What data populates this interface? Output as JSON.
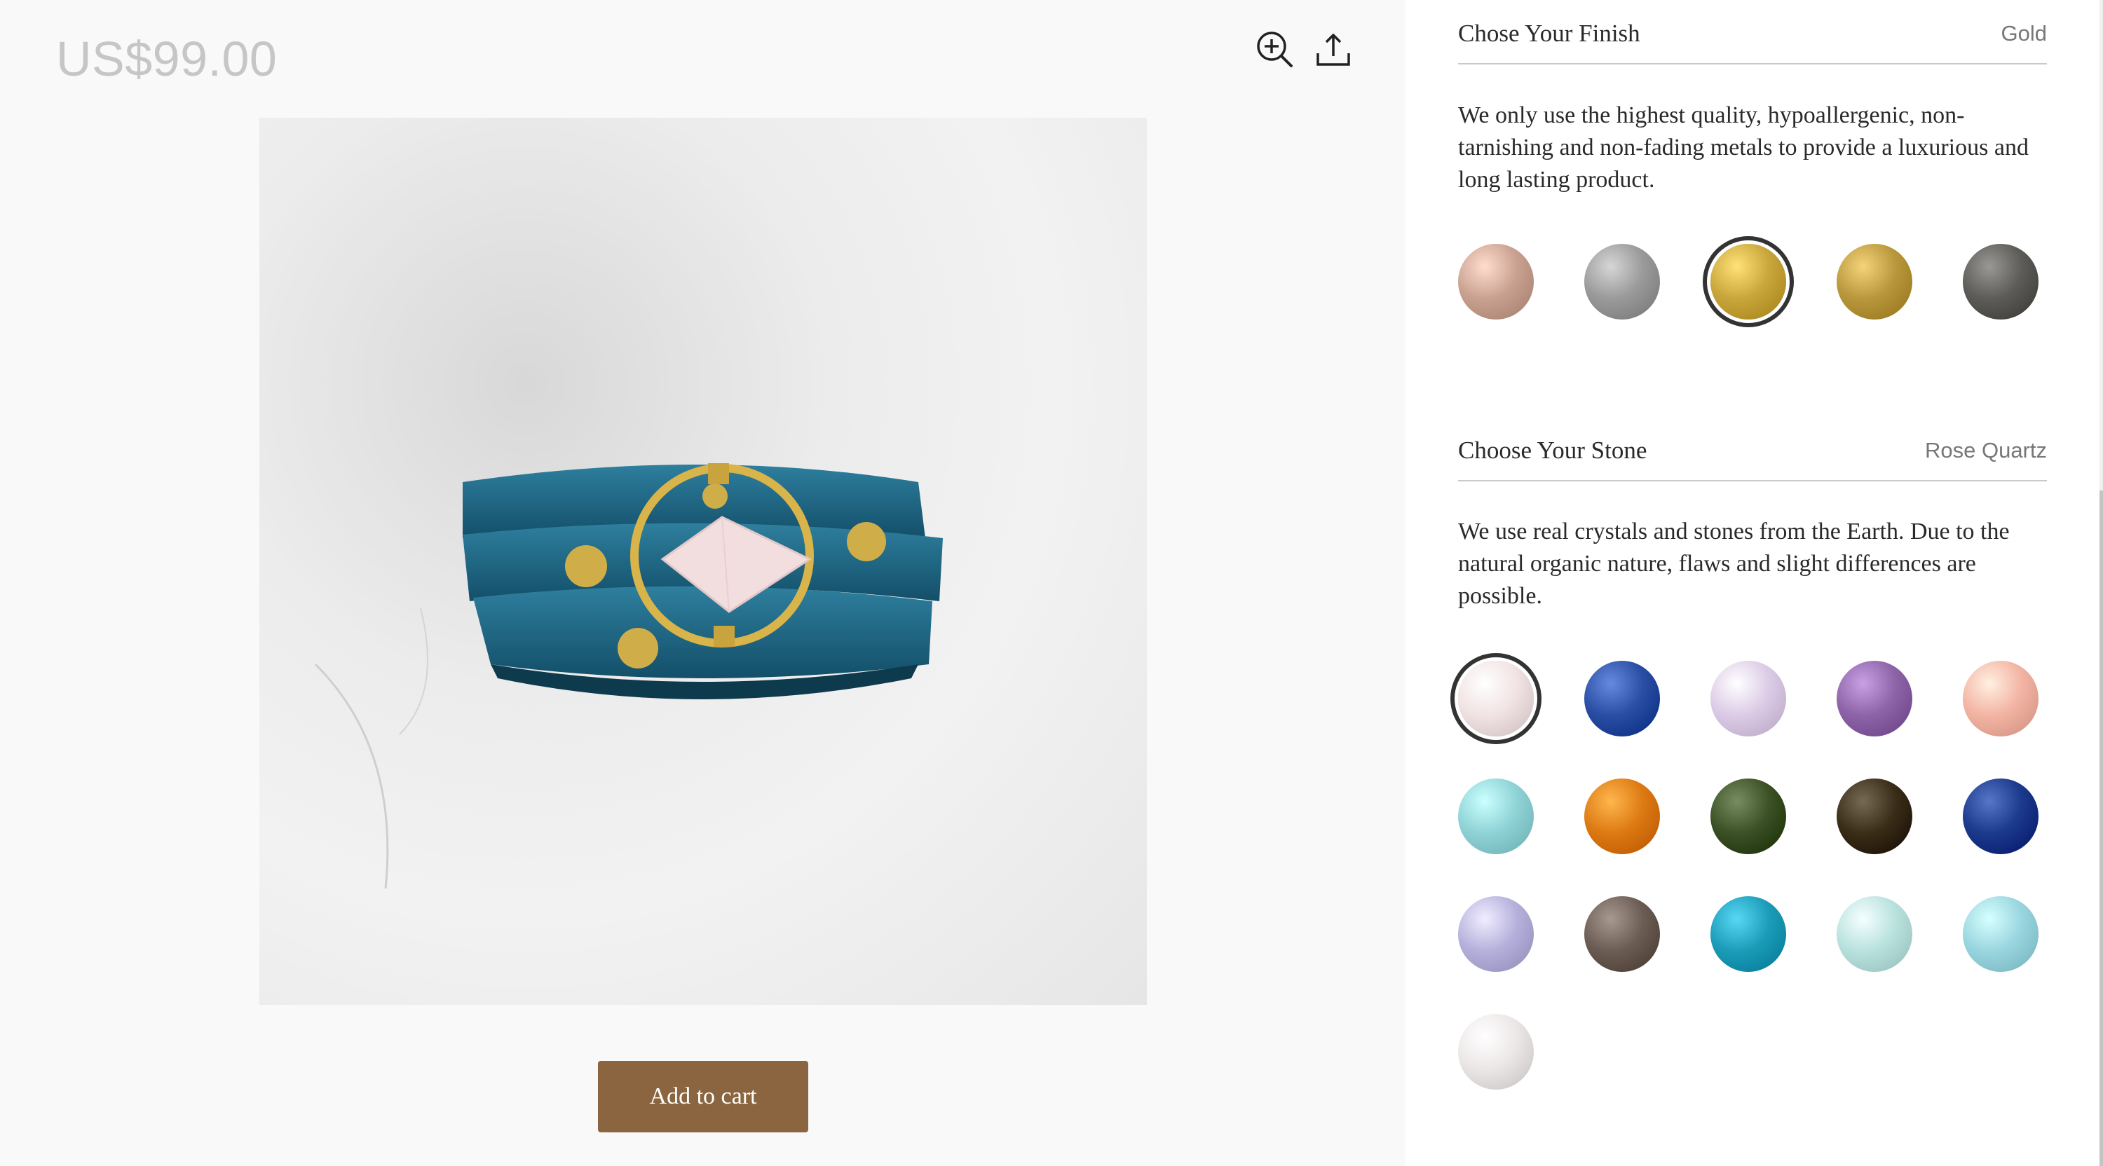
{
  "product": {
    "price": "US$99.00"
  },
  "toolbar": {
    "zoom_icon": "zoom-in-icon",
    "share_icon": "share-upload-icon"
  },
  "cart": {
    "label": "Add to cart"
  },
  "finish": {
    "title": "Chose Your Finish",
    "selected": "Gold",
    "description": "We only use the highest quality, hypoallergenic, non-tarnishing and non-fading metals to provide a luxurious and long lasting product.",
    "swatches": [
      {
        "color": "#c9a191"
      },
      {
        "color": "#9a9a9a"
      },
      {
        "color": "#c9a63c",
        "selected": true
      },
      {
        "color": "#b9983d"
      },
      {
        "color": "#5e5c58"
      }
    ]
  },
  "stone": {
    "title": "Choose Your Stone",
    "selected": "Rose Quartz",
    "description": "We use real crystals and stones from the Earth. Due to the natural organic nature, flaws and slight differences are possible.",
    "swatches": [
      {
        "color": "#f1e3e3",
        "selected": true
      },
      {
        "color": "#2a4ea4"
      },
      {
        "color": "#dccbe6"
      },
      {
        "color": "#8e64a8"
      },
      {
        "color": "#f3b4a4"
      },
      {
        "color": "#8fd3d6"
      },
      {
        "color": "#dd7a12"
      },
      {
        "color": "#3c5126"
      },
      {
        "color": "#3a2e18"
      },
      {
        "color": "#1c3a8c"
      },
      {
        "color": "#b5b1dc"
      },
      {
        "color": "#6b5d54"
      },
      {
        "color": "#1c9cb8"
      },
      {
        "color": "#b9e2de"
      },
      {
        "color": "#9ad6df"
      },
      {
        "color": "#ece7e7"
      }
    ]
  }
}
